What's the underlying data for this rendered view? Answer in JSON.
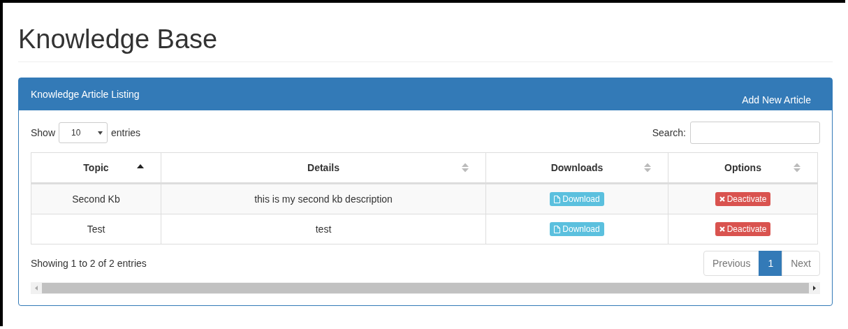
{
  "page_title": "Knowledge Base",
  "panel": {
    "title": "Knowledge Article Listing",
    "action": "Add New Article"
  },
  "length": {
    "label_before": "Show",
    "value": "10",
    "label_after": "entries"
  },
  "search": {
    "label": "Search:"
  },
  "table": {
    "columns": [
      {
        "label": "Topic",
        "sorted": true
      },
      {
        "label": "Details",
        "sorted": false
      },
      {
        "label": "Downloads",
        "sorted": false
      },
      {
        "label": "Options",
        "sorted": false
      }
    ],
    "rows": [
      {
        "topic": "Second Kb",
        "details": "this is my second kb description",
        "download": "Download",
        "deactivate": "Deactivate"
      },
      {
        "topic": "Test",
        "details": "test",
        "download": "Download",
        "deactivate": "Deactivate"
      }
    ]
  },
  "info": "Showing 1 to 2 of 2 entries",
  "pagination": [
    {
      "label": "Previous",
      "selected": false,
      "disabled": true
    },
    {
      "label": "1",
      "selected": true,
      "disabled": false
    },
    {
      "label": "Next",
      "selected": false,
      "disabled": true
    }
  ]
}
